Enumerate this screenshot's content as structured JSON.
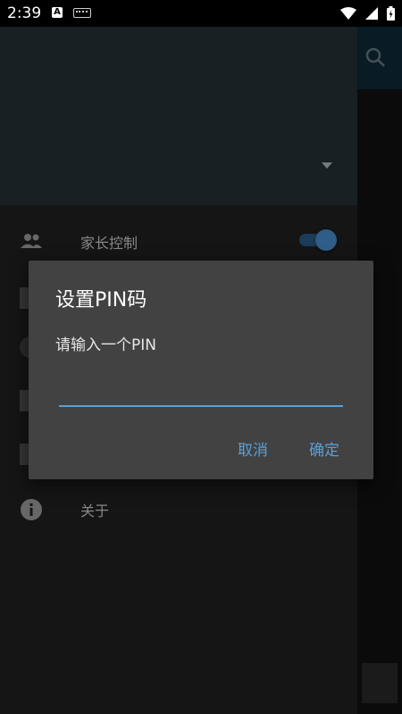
{
  "status_bar": {
    "time": "2:39",
    "notification_icons": [
      "a-icon",
      "keyboard-icon"
    ],
    "system_icons": [
      "wifi-icon",
      "signal-icon",
      "battery-icon"
    ]
  },
  "drawer": {
    "items": [
      {
        "icon": "people-icon",
        "label": "家长控制",
        "toggle_on": true
      },
      {
        "icon": "info-icon",
        "label": "关于"
      }
    ]
  },
  "dialog": {
    "title": "设置PIN码",
    "message": "请输入一个PIN",
    "input_value": "",
    "cancel_label": "取消",
    "ok_label": "确定"
  },
  "colors": {
    "accent": "#5aa0d8",
    "drawer_header": "#263238",
    "dialog_bg": "#424242"
  }
}
